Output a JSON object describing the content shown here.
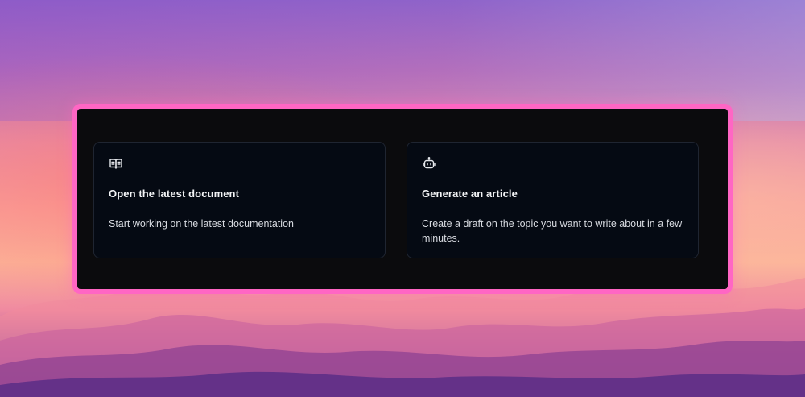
{
  "cards": [
    {
      "icon": "book-open-icon",
      "title": "Open the latest document",
      "description": "Start working on the latest documentation"
    },
    {
      "icon": "robot-icon",
      "title": "Generate an article",
      "description": "Create a draft on the topic you want to write about in a few minutes."
    }
  ],
  "colors": {
    "panel_border": "#ff66c4",
    "panel_background": "#0b0b0d",
    "card_background": "#050a13",
    "card_border": "#1f2531",
    "text_primary": "#f3f4f6"
  }
}
